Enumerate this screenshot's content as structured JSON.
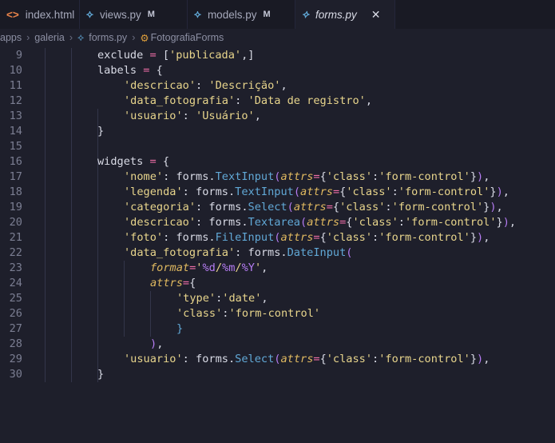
{
  "tabs": [
    {
      "label": "index.html",
      "icon": "html-icon",
      "glyph": "<>",
      "modified": "",
      "active": false
    },
    {
      "label": "views.py",
      "icon": "python-icon",
      "glyph": "⟡",
      "modified": "M",
      "active": false
    },
    {
      "label": "models.py",
      "icon": "python-icon",
      "glyph": "⟡",
      "modified": "M",
      "active": false
    },
    {
      "label": "forms.py",
      "icon": "python-icon",
      "glyph": "⟡",
      "modified": "",
      "active": true
    }
  ],
  "breadcrumb": [
    "apps",
    "galeria",
    "forms.py",
    "FotografiaForms"
  ],
  "code_lines": [
    {
      "n": "9",
      "indent": 2,
      "tokens": [
        [
          "k",
          "exclude "
        ],
        [
          "op",
          "="
        ],
        [
          "k",
          " ["
        ],
        [
          "s",
          "'publicada'"
        ],
        [
          "k",
          ",]"
        ]
      ]
    },
    {
      "n": "10",
      "indent": 2,
      "tokens": [
        [
          "k",
          "labels "
        ],
        [
          "op",
          "="
        ],
        [
          "k",
          " {"
        ]
      ]
    },
    {
      "n": "11",
      "indent": 3,
      "tokens": [
        [
          "s",
          "'descricao'"
        ],
        [
          "k",
          ": "
        ],
        [
          "s",
          "'Descrição'"
        ],
        [
          "k",
          ","
        ]
      ]
    },
    {
      "n": "12",
      "indent": 3,
      "tokens": [
        [
          "s",
          "'data_fotografia'"
        ],
        [
          "k",
          ": "
        ],
        [
          "s",
          "'Data de registro'"
        ],
        [
          "k",
          ","
        ]
      ]
    },
    {
      "n": "13",
      "indent": 3,
      "tokens": [
        [
          "s",
          "'usuario'"
        ],
        [
          "k",
          ": "
        ],
        [
          "s",
          "'Usuário'"
        ],
        [
          "k",
          ","
        ]
      ]
    },
    {
      "n": "14",
      "indent": 2,
      "tokens": [
        [
          "k",
          "}"
        ]
      ]
    },
    {
      "n": "15",
      "indent": 0,
      "tokens": []
    },
    {
      "n": "16",
      "indent": 2,
      "tokens": [
        [
          "k",
          "widgets "
        ],
        [
          "op",
          "="
        ],
        [
          "k",
          " {"
        ]
      ]
    },
    {
      "n": "17",
      "indent": 3,
      "tokens": [
        [
          "s",
          "'nome'"
        ],
        [
          "k",
          ": forms."
        ],
        [
          "c",
          "TextInput"
        ],
        [
          "p",
          "("
        ],
        [
          "a",
          "attrs"
        ],
        [
          "op",
          "="
        ],
        [
          "k",
          "{"
        ],
        [
          "s",
          "'class'"
        ],
        [
          "k",
          ":"
        ],
        [
          "s",
          "'form-control'"
        ],
        [
          "k",
          "}"
        ],
        [
          "p",
          ")"
        ],
        [
          "k",
          ","
        ]
      ]
    },
    {
      "n": "18",
      "indent": 3,
      "tokens": [
        [
          "s",
          "'legenda'"
        ],
        [
          "k",
          ": forms."
        ],
        [
          "c",
          "TextInput"
        ],
        [
          "p",
          "("
        ],
        [
          "a",
          "attrs"
        ],
        [
          "op",
          "="
        ],
        [
          "k",
          "{"
        ],
        [
          "s",
          "'class'"
        ],
        [
          "k",
          ":"
        ],
        [
          "s",
          "'form-control'"
        ],
        [
          "k",
          "}"
        ],
        [
          "p",
          ")"
        ],
        [
          "k",
          ","
        ]
      ]
    },
    {
      "n": "19",
      "indent": 3,
      "tokens": [
        [
          "s",
          "'categoria'"
        ],
        [
          "k",
          ": forms."
        ],
        [
          "c",
          "Select"
        ],
        [
          "p",
          "("
        ],
        [
          "a",
          "attrs"
        ],
        [
          "op",
          "="
        ],
        [
          "k",
          "{"
        ],
        [
          "s",
          "'class'"
        ],
        [
          "k",
          ":"
        ],
        [
          "s",
          "'form-control'"
        ],
        [
          "k",
          "}"
        ],
        [
          "p",
          ")"
        ],
        [
          "k",
          ","
        ]
      ]
    },
    {
      "n": "20",
      "indent": 3,
      "tokens": [
        [
          "s",
          "'descricao'"
        ],
        [
          "k",
          ": forms."
        ],
        [
          "c",
          "Textarea"
        ],
        [
          "p",
          "("
        ],
        [
          "a",
          "attrs"
        ],
        [
          "op",
          "="
        ],
        [
          "k",
          "{"
        ],
        [
          "s",
          "'class'"
        ],
        [
          "k",
          ":"
        ],
        [
          "s",
          "'form-control'"
        ],
        [
          "k",
          "}"
        ],
        [
          "p",
          ")"
        ],
        [
          "k",
          ","
        ]
      ]
    },
    {
      "n": "21",
      "indent": 3,
      "tokens": [
        [
          "s",
          "'foto'"
        ],
        [
          "k",
          ": forms."
        ],
        [
          "c",
          "FileInput"
        ],
        [
          "p",
          "("
        ],
        [
          "a",
          "attrs"
        ],
        [
          "op",
          "="
        ],
        [
          "k",
          "{"
        ],
        [
          "s",
          "'class'"
        ],
        [
          "k",
          ":"
        ],
        [
          "s",
          "'form-control'"
        ],
        [
          "k",
          "}"
        ],
        [
          "p",
          ")"
        ],
        [
          "k",
          ","
        ]
      ]
    },
    {
      "n": "22",
      "indent": 3,
      "tokens": [
        [
          "s",
          "'data_fotografia'"
        ],
        [
          "k",
          ": forms."
        ],
        [
          "c",
          "DateInput"
        ],
        [
          "p",
          "("
        ]
      ]
    },
    {
      "n": "23",
      "indent": 4,
      "tokens": [
        [
          "a",
          "format"
        ],
        [
          "op",
          "="
        ],
        [
          "s",
          "'"
        ],
        [
          "p",
          "%d"
        ],
        [
          "s",
          "/"
        ],
        [
          "p",
          "%m"
        ],
        [
          "s",
          "/"
        ],
        [
          "p",
          "%Y"
        ],
        [
          "s",
          "'"
        ],
        [
          "k",
          ","
        ]
      ]
    },
    {
      "n": "24",
      "indent": 4,
      "tokens": [
        [
          "a",
          "attrs"
        ],
        [
          "op",
          "="
        ],
        [
          "k",
          "{"
        ]
      ]
    },
    {
      "n": "25",
      "indent": 5,
      "tokens": [
        [
          "s",
          "'type'"
        ],
        [
          "k",
          ":"
        ],
        [
          "s",
          "'date'"
        ],
        [
          "k",
          ","
        ]
      ]
    },
    {
      "n": "26",
      "indent": 5,
      "tokens": [
        [
          "s",
          "'class'"
        ],
        [
          "k",
          ":"
        ],
        [
          "s",
          "'form-control'"
        ]
      ]
    },
    {
      "n": "27",
      "indent": 5,
      "tokens": [
        [
          "c",
          "}"
        ]
      ]
    },
    {
      "n": "28",
      "indent": 4,
      "tokens": [
        [
          "p",
          ")"
        ],
        [
          "k",
          ","
        ]
      ]
    },
    {
      "n": "29",
      "indent": 3,
      "tokens": [
        [
          "s",
          "'usuario'"
        ],
        [
          "k",
          ": forms."
        ],
        [
          "c",
          "Select"
        ],
        [
          "p",
          "("
        ],
        [
          "a",
          "attrs"
        ],
        [
          "op",
          "="
        ],
        [
          "k",
          "{"
        ],
        [
          "s",
          "'class'"
        ],
        [
          "k",
          ":"
        ],
        [
          "s",
          "'form-control'"
        ],
        [
          "k",
          "}"
        ],
        [
          "p",
          ")"
        ],
        [
          "k",
          ","
        ]
      ]
    },
    {
      "n": "30",
      "indent": 2,
      "tokens": [
        [
          "k",
          "}"
        ]
      ]
    }
  ]
}
